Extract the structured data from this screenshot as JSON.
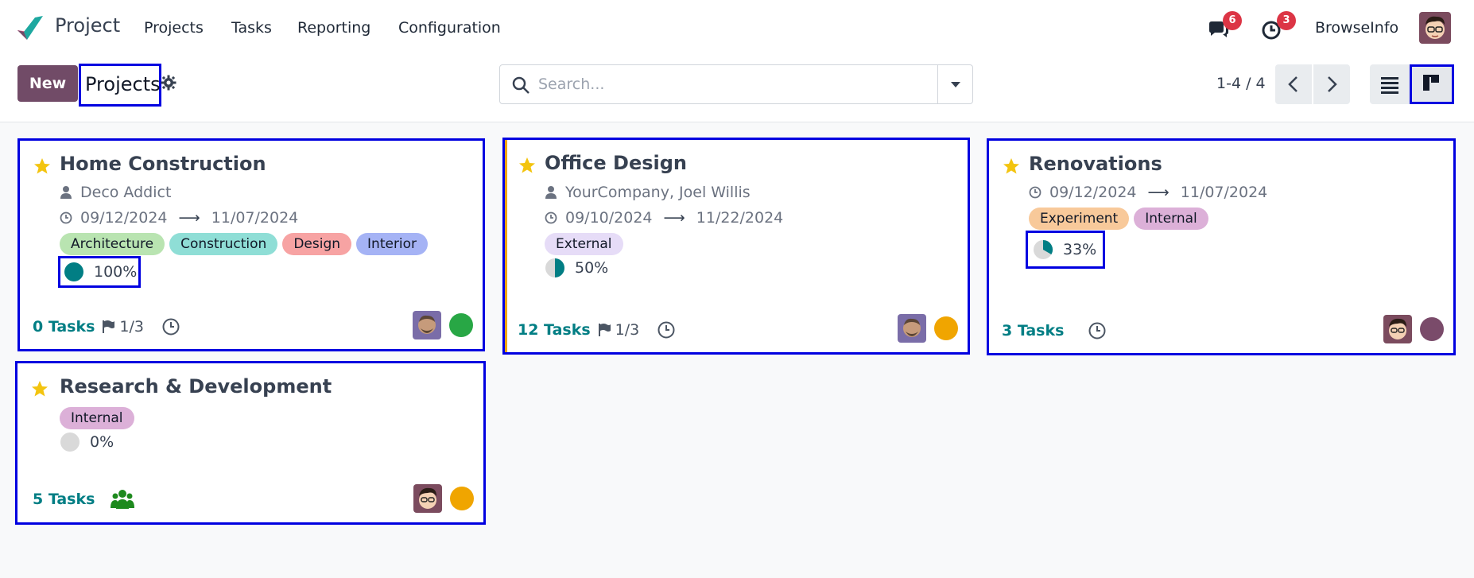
{
  "navbar": {
    "brand": "Project",
    "menu": [
      "Projects",
      "Tasks",
      "Reporting",
      "Configuration"
    ],
    "messages_badge": "6",
    "activities_badge": "3",
    "company": "BrowseInfo"
  },
  "control": {
    "new_label": "New",
    "title": "Projects",
    "search_placeholder": "Search...",
    "pager": "1-4 / 4"
  },
  "colors": {
    "brand_purple": "#714b67",
    "teal": "#017e84",
    "highlight_box": "#0000e0",
    "star": "#f3c40f"
  },
  "projects": [
    {
      "name": "Home Construction",
      "customer": "Deco Addict",
      "start": "09/12/2024",
      "end": "11/07/2024",
      "tags": [
        {
          "label": "Architecture",
          "color": "#b9e4b1"
        },
        {
          "label": "Construction",
          "color": "#8fded6"
        },
        {
          "label": "Design",
          "color": "#f7a3a3"
        },
        {
          "label": "Interior",
          "color": "#a5b3f5"
        }
      ],
      "progress_label": "100%",
      "progress_fraction": 1.0,
      "tasks": "0 Tasks",
      "milestones": "1/3",
      "status_color": "#28a745",
      "favorite": true
    },
    {
      "name": "Office Design",
      "customer": "YourCompany, Joel Willis",
      "start": "09/10/2024",
      "end": "11/22/2024",
      "tags": [
        {
          "label": "External",
          "color": "#e6dcf7"
        }
      ],
      "progress_label": "50%",
      "progress_fraction": 0.5,
      "tasks": "12 Tasks",
      "milestones": "1/3",
      "status_color": "#f0a500",
      "favorite": true
    },
    {
      "name": "Renovations",
      "customer": "",
      "start": "09/12/2024",
      "end": "11/07/2024",
      "tags": [
        {
          "label": "Experiment",
          "color": "#f8c99a"
        },
        {
          "label": "Internal",
          "color": "#dcb0d8"
        }
      ],
      "progress_label": "33%",
      "progress_fraction": 0.33,
      "tasks": "3 Tasks",
      "milestones": "",
      "status_color": "#7a4b6a",
      "favorite": true
    },
    {
      "name": "Research & Development",
      "customer": "",
      "start": "",
      "end": "",
      "tags": [
        {
          "label": "Internal",
          "color": "#dcb0d8"
        }
      ],
      "progress_label": "0%",
      "progress_fraction": 0.0,
      "tasks": "5 Tasks",
      "milestones": "",
      "status_color": "#f0a500",
      "favorite": true
    }
  ]
}
